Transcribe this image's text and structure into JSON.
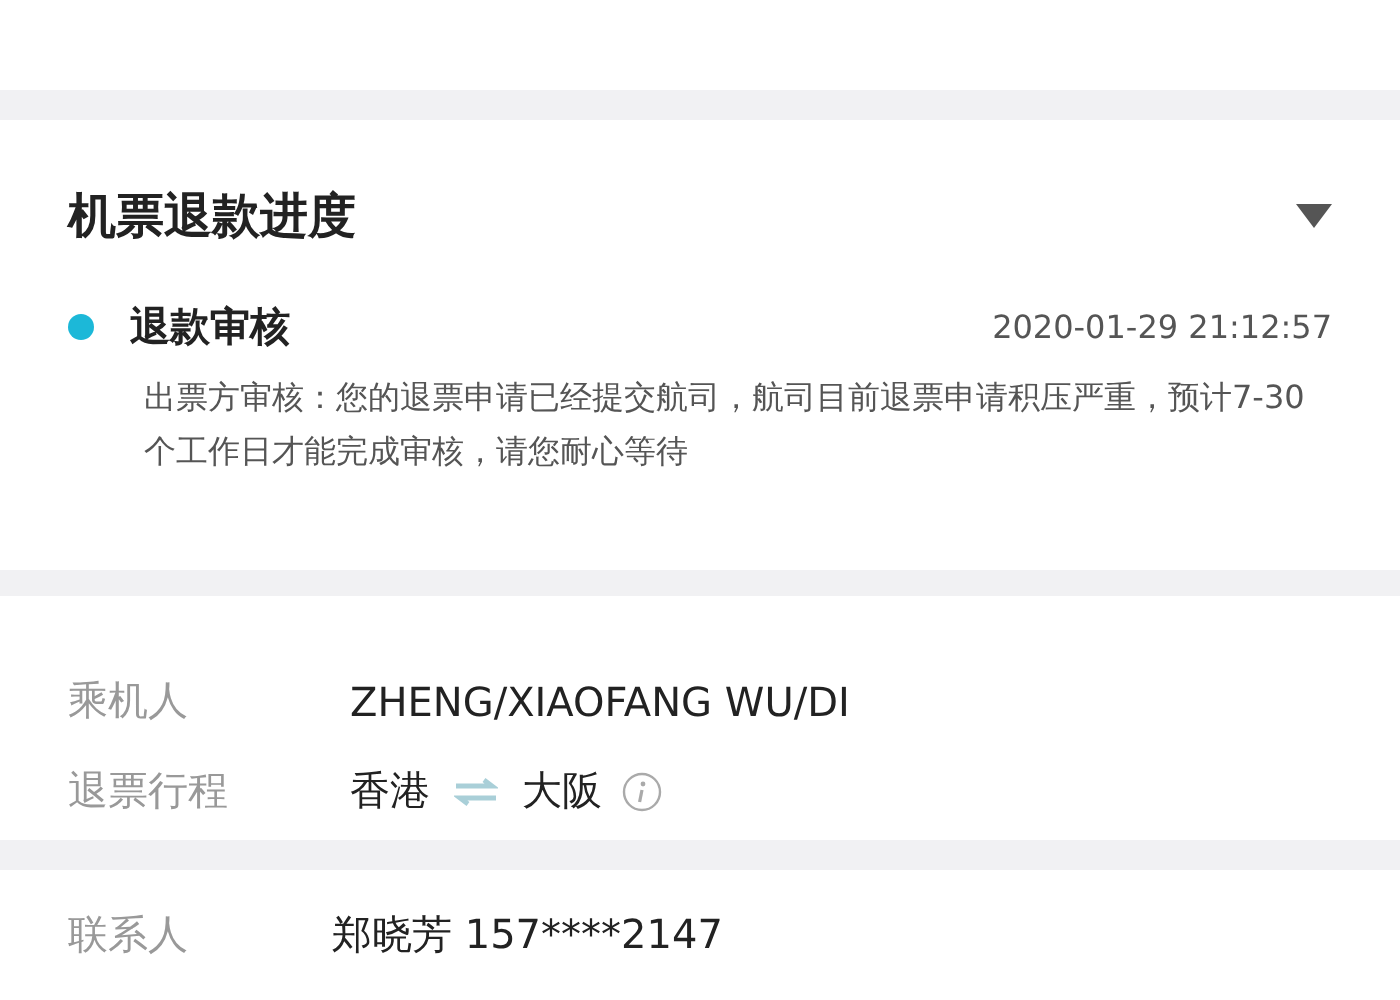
{
  "refund_progress": {
    "title": "机票退款进度",
    "expanded": true,
    "steps": [
      {
        "status": "退款审核",
        "color": "#1cb8d8",
        "time": "2020-01-29 21:12:57",
        "description": "出票方审核：您的退票申请已经提交航司，航司目前退票申请积压严重，预计7-30个工作日才能完成审核，请您耐心等待"
      }
    ]
  },
  "passenger_info": {
    "passenger_label": "乘机人",
    "passenger": "ZHENG/XIAOFANG WU/DI",
    "route_label": "退票行程",
    "route_from": "香港",
    "route_to": "大阪"
  },
  "contact": {
    "label": "联系人",
    "value": "郑晓芳 157****2147"
  }
}
